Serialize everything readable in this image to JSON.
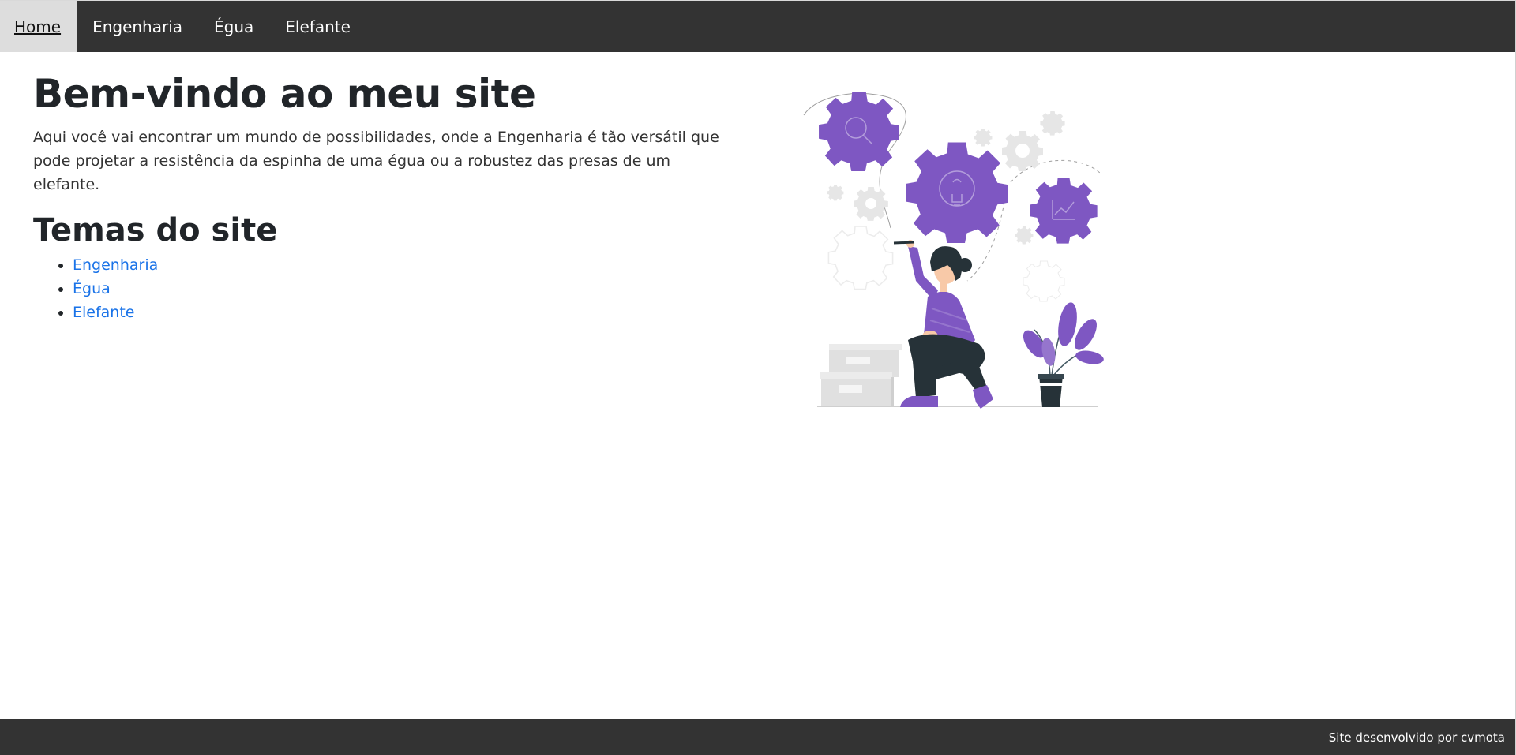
{
  "nav": {
    "items": [
      {
        "label": "Home",
        "active": true
      },
      {
        "label": "Engenharia",
        "active": false
      },
      {
        "label": "Égua",
        "active": false
      },
      {
        "label": "Elefante",
        "active": false
      }
    ]
  },
  "main": {
    "title": "Bem-vindo ao meu site",
    "intro": "Aqui você vai encontrar um mundo de possibilidades, onde a Engenharia é tão versátil que pode projetar a resistência da espinha de uma égua ou a robustez das presas de um elefante.",
    "topics_title": "Temas do site",
    "topics": [
      {
        "label": "Engenharia"
      },
      {
        "label": "Égua"
      },
      {
        "label": "Elefante"
      }
    ]
  },
  "illustration": {
    "icon": "engineer-with-gears-illustration",
    "accent_color": "#7e57c2",
    "dark_color": "#263238",
    "light_gray": "#e0e0e0"
  },
  "footer": {
    "text": "Site desenvolvido por cvmota"
  },
  "colors": {
    "nav_bg": "#333333",
    "nav_active_bg": "#dddddd",
    "link": "#1a73e8"
  }
}
